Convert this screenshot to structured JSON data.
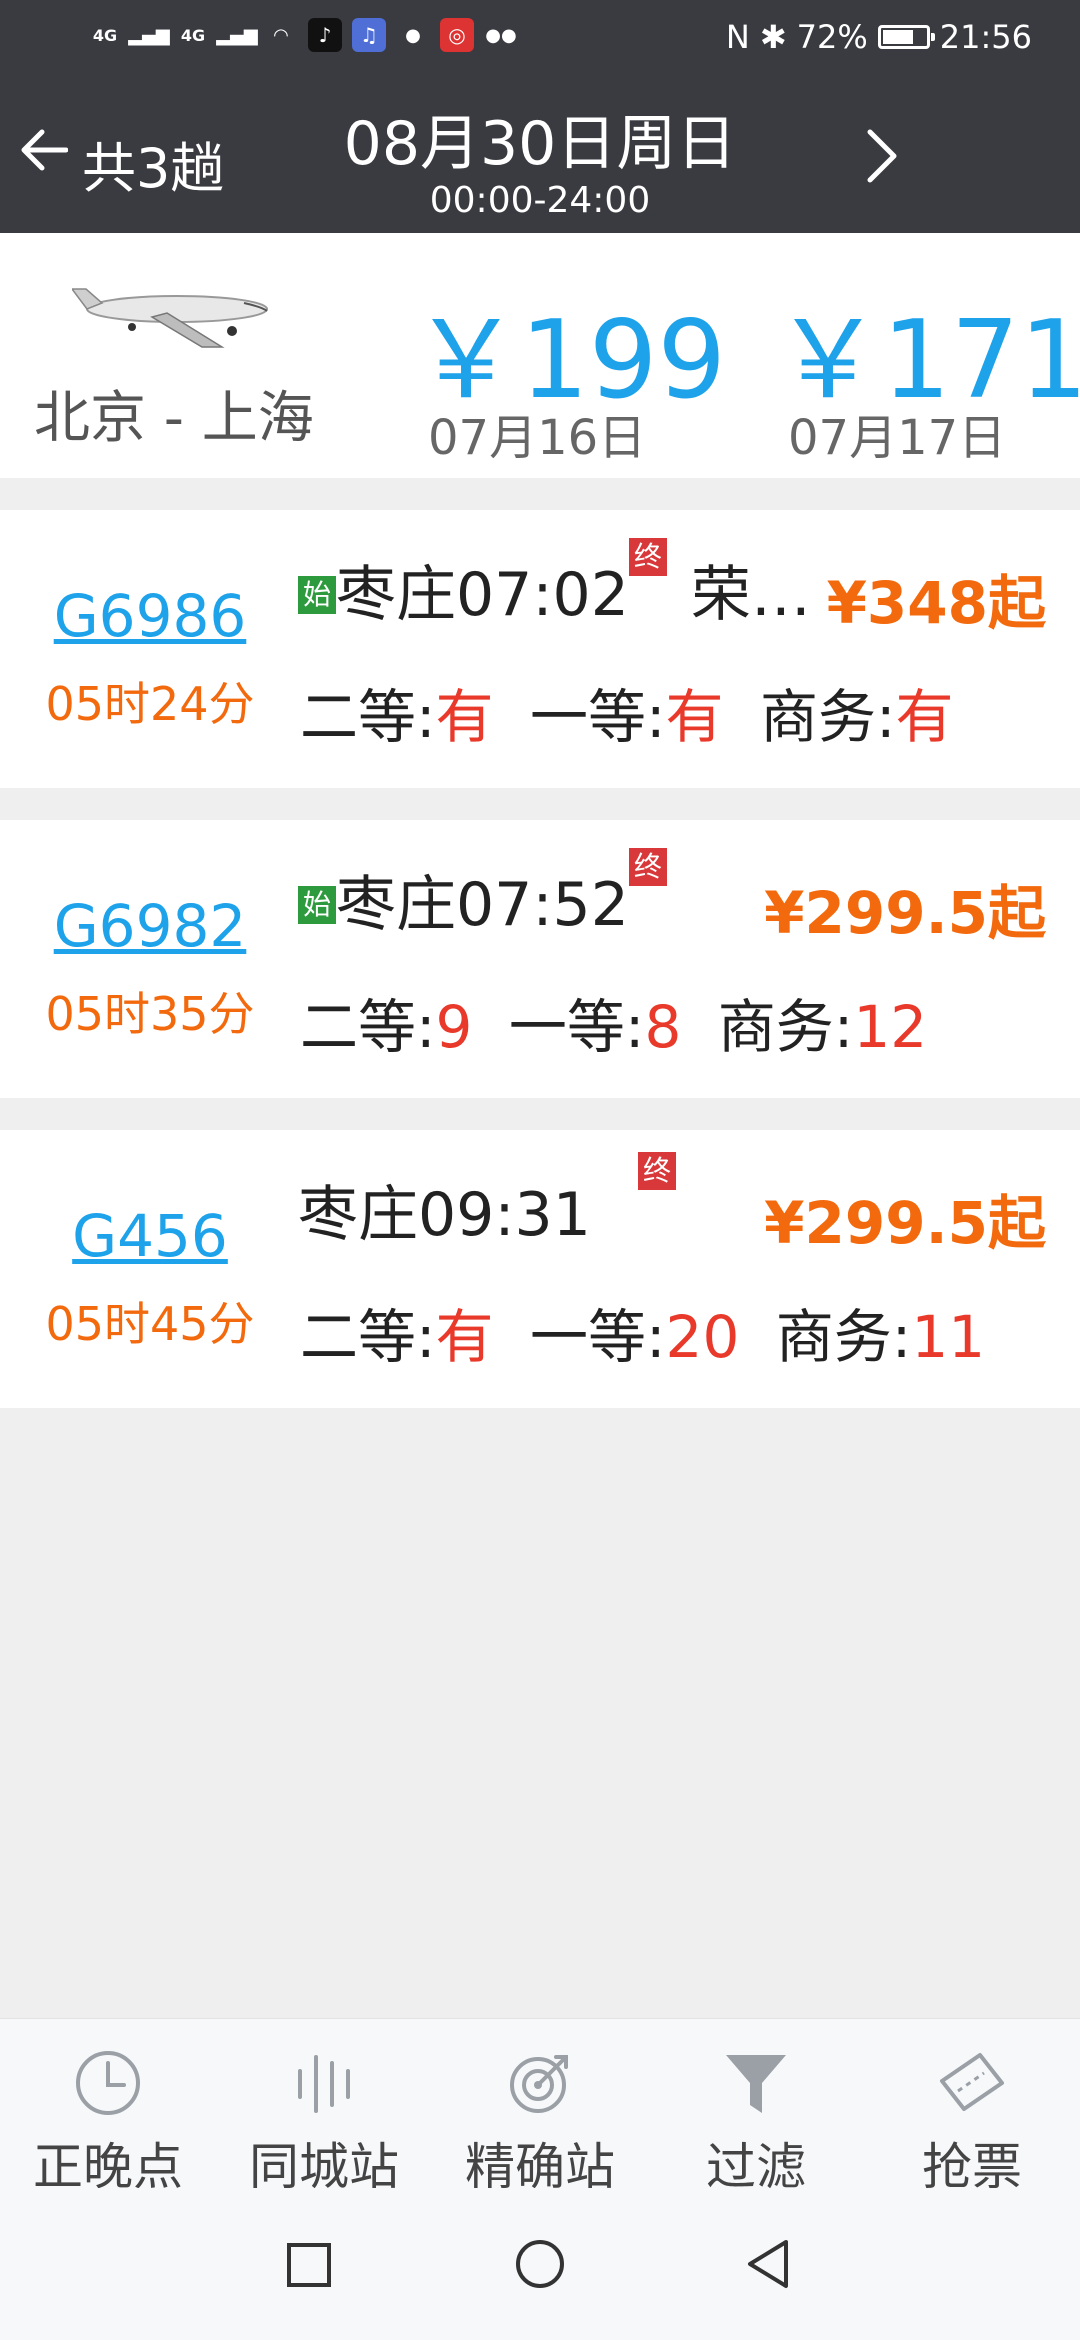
{
  "status": {
    "signal1": "4G",
    "signal2": "4G",
    "battery_pct": "72%",
    "battery_level": 0.72,
    "time": "21:56"
  },
  "header": {
    "back_label": "共3趟",
    "date_title": "08月30日周日",
    "time_range": "00:00-24:00"
  },
  "flight": {
    "route": "北京 - 上海",
    "prices": [
      {
        "price": "￥199",
        "date": "07月16日"
      },
      {
        "price": "￥171",
        "date": "07月17日"
      }
    ]
  },
  "trains": [
    {
      "number": "G6986",
      "duration": "05时24分",
      "start_badge": "始",
      "end_badge": "终",
      "depart": "枣庄07:02",
      "arrive": "荣…",
      "price": "¥348起",
      "seats": [
        {
          "label": "二等:",
          "value": "有"
        },
        {
          "label": "一等:",
          "value": "有"
        },
        {
          "label": "商务:",
          "value": "有"
        }
      ]
    },
    {
      "number": "G6982",
      "duration": "05时35分",
      "start_badge": "始",
      "end_badge": "终",
      "depart": "枣庄07:52",
      "arrive": "",
      "price": "¥299.5起",
      "seats": [
        {
          "label": "二等:",
          "value": "9"
        },
        {
          "label": "一等:",
          "value": "8"
        },
        {
          "label": "商务:",
          "value": "12"
        }
      ]
    },
    {
      "number": "G456",
      "duration": "05时45分",
      "start_badge": "",
      "end_badge": "终",
      "depart": "枣庄09:31",
      "arrive": "",
      "price": "¥299.5起",
      "seats": [
        {
          "label": "二等:",
          "value": "有"
        },
        {
          "label": "一等:",
          "value": "20"
        },
        {
          "label": "商务:",
          "value": "11"
        }
      ]
    }
  ],
  "tabs": [
    {
      "label": "正晚点",
      "icon": "clock-icon"
    },
    {
      "label": "同城站",
      "icon": "bars-icon"
    },
    {
      "label": "精确站",
      "icon": "target-icon"
    },
    {
      "label": "过滤",
      "icon": "filter-icon"
    },
    {
      "label": "抢票",
      "icon": "ticket-icon"
    }
  ],
  "colors": {
    "header_bg": "#3a3b40",
    "accent_blue": "#1ea2ea",
    "accent_orange": "#f26a0d",
    "seat_red": "#e8392a",
    "start_green": "#2c9a3d",
    "end_red": "#d8383a"
  }
}
